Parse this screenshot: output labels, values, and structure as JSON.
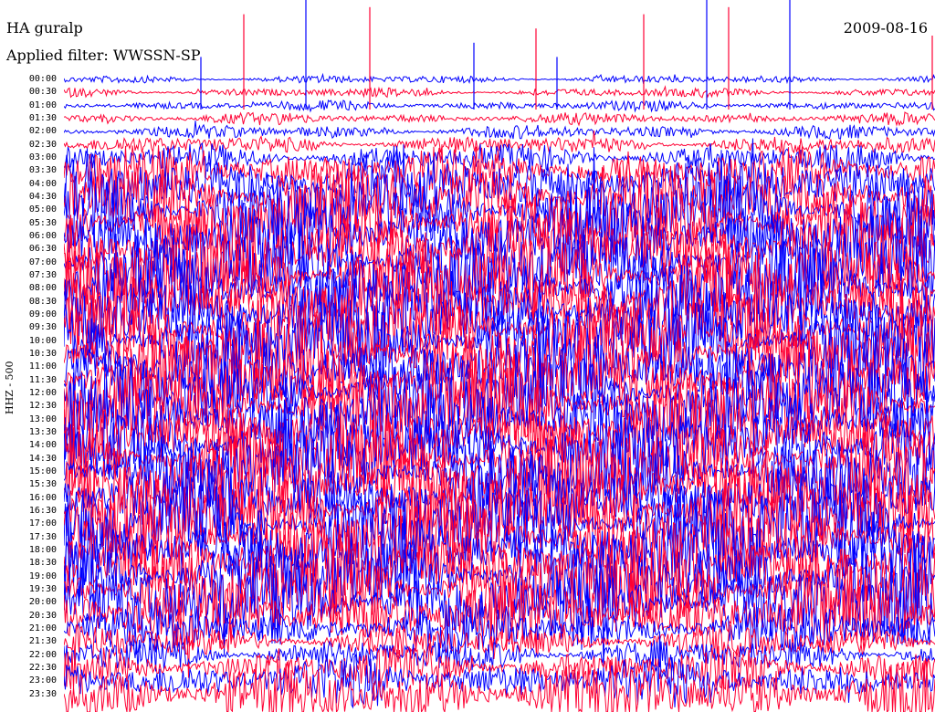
{
  "header": {
    "station": "HA guralp",
    "date": "2009-08-16",
    "filter": "Applied filter: WWSSN-SP"
  },
  "chart_data": {
    "type": "line",
    "title": "HA guralp",
    "ylabel": "HHZ - 500",
    "row_colors": [
      "#0000ff",
      "#ff0033"
    ],
    "grid": false,
    "categories": [
      "00:00",
      "00:30",
      "01:00",
      "01:30",
      "02:00",
      "02:30",
      "03:00",
      "03:30",
      "04:00",
      "04:30",
      "05:00",
      "05:30",
      "06:00",
      "06:30",
      "07:00",
      "07:30",
      "08:00",
      "08:30",
      "09:00",
      "09:30",
      "10:00",
      "10:30",
      "11:00",
      "11:30",
      "12:00",
      "12:30",
      "13:00",
      "13:30",
      "14:00",
      "14:30",
      "15:00",
      "15:30",
      "16:00",
      "16:30",
      "17:00",
      "17:30",
      "18:00",
      "18:30",
      "19:00",
      "19:30",
      "20:00",
      "20:30",
      "21:00",
      "21:30",
      "22:00",
      "22:30",
      "23:00",
      "23:30"
    ],
    "relative_amplitude": [
      0.35,
      0.4,
      0.45,
      0.5,
      0.6,
      0.8,
      1.2,
      2.2,
      3.0,
      3.4,
      3.6,
      3.8,
      3.9,
      4.0,
      4.0,
      4.0,
      4.0,
      4.0,
      4.0,
      4.0,
      4.0,
      4.0,
      4.0,
      4.0,
      4.0,
      4.0,
      4.0,
      4.0,
      4.0,
      4.0,
      4.0,
      4.0,
      4.0,
      4.0,
      4.0,
      4.0,
      4.0,
      4.0,
      4.0,
      4.0,
      4.0,
      3.2,
      2.0,
      1.5,
      1.5,
      1.8,
      2.2,
      2.8
    ]
  }
}
